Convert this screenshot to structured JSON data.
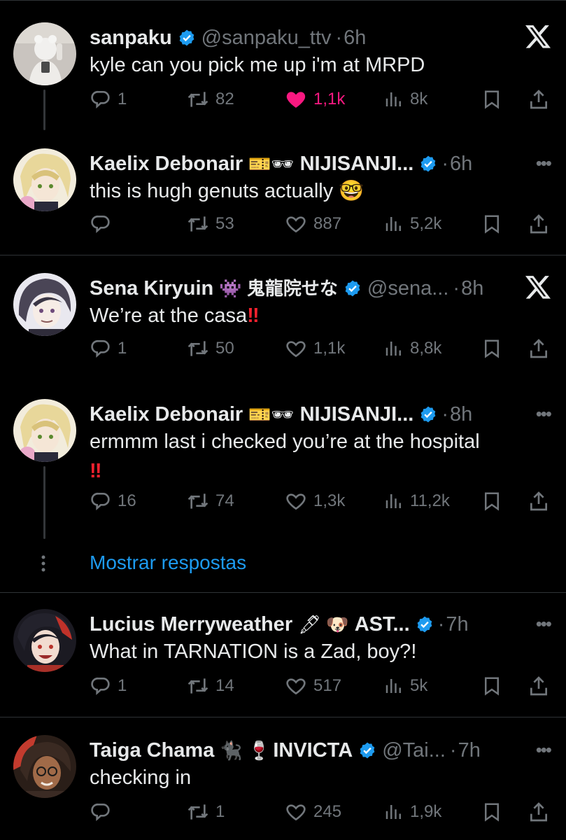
{
  "colors": {
    "background": "#000000",
    "text": "#e7e9ea",
    "muted": "#71767b",
    "link": "#1d9bf0",
    "like": "#f91880",
    "verified": "#1d9bf0",
    "divider": "#2f3336"
  },
  "tweets": [
    {
      "name": "sanpaku",
      "emoji": "",
      "handle": "@sanpaku_ttv",
      "time": "6h",
      "text": "kyle can you pick me up i'm at MRPD",
      "trailing_emoji": "",
      "replies": "1",
      "retweets": "82",
      "likes": "1,1k",
      "liked": true,
      "views": "8k",
      "menu": "x-logo-icon"
    },
    {
      "name": "Kaelix Debonair",
      "emoji": "🎫🕶",
      "handle": "NIJISANJI...",
      "time": "6h",
      "text": "this is hugh genuts actually ",
      "trailing_emoji": "🤓",
      "replies": "",
      "retweets": "53",
      "likes": "887",
      "liked": false,
      "views": "5,2k",
      "menu": "more-icon"
    },
    {
      "name": "Sena Kiryuin",
      "emoji": "👾 鬼龍院せな",
      "handle": "@sena...",
      "time": "8h",
      "text": "We’re at the casa",
      "trailing_emoji": "‼",
      "replies": "1",
      "retweets": "50",
      "likes": "1,1k",
      "liked": false,
      "views": "8,8k",
      "menu": "x-logo-icon"
    },
    {
      "name": "Kaelix Debonair",
      "emoji": "🎫🕶",
      "handle": "NIJISANJI...",
      "time": "8h",
      "text": "ermmm last i checked you’re at the hospital",
      "trailing_emoji": "‼",
      "replies": "16",
      "retweets": "74",
      "likes": "1,3k",
      "liked": false,
      "views": "11,2k",
      "menu": "more-icon"
    },
    {
      "name": "Lucius Merryweather",
      "emoji": "🖋 🐶",
      "handle": "AST...",
      "time": "7h",
      "text": "What in TARNATION is a Zad, boy?!",
      "trailing_emoji": "",
      "replies": "1",
      "retweets": "14",
      "likes": "517",
      "liked": false,
      "views": "5k",
      "menu": "more-icon"
    },
    {
      "name": "Taiga Chama",
      "emoji": "🐈‍⬛ 🍷",
      "handle": "INVICTA",
      "handle2": "@Tai...",
      "time": "7h",
      "text": "checking in",
      "trailing_emoji": "",
      "replies": "",
      "retweets": "1",
      "likes": "245",
      "liked": false,
      "views": "1,9k",
      "menu": "more-icon"
    }
  ],
  "show_replies": "Mostrar respostas"
}
